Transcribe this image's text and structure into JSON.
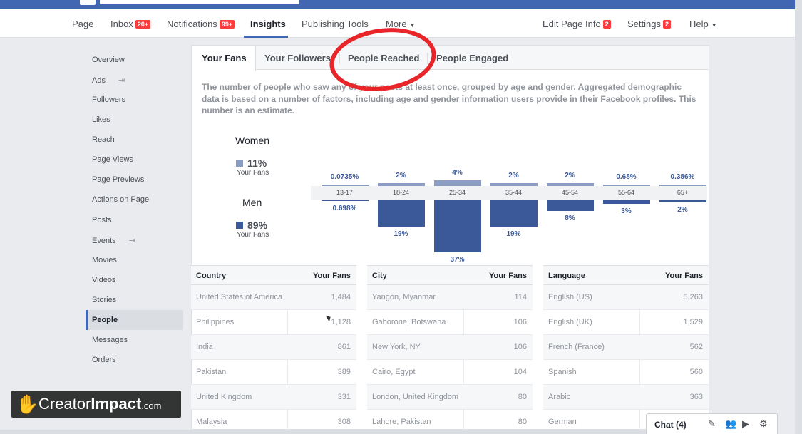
{
  "nav": {
    "page": "Page",
    "inbox": "Inbox",
    "inbox_badge": "20+",
    "notifications": "Notifications",
    "notifications_badge": "99+",
    "insights": "Insights",
    "publishing_tools": "Publishing Tools",
    "more": "More",
    "edit_page_info": "Edit Page Info",
    "edit_badge": "2",
    "settings": "Settings",
    "settings_badge": "2",
    "help": "Help"
  },
  "sidebar": {
    "items": [
      {
        "label": "Overview"
      },
      {
        "label": "Ads"
      },
      {
        "label": "Followers"
      },
      {
        "label": "Likes"
      },
      {
        "label": "Reach"
      },
      {
        "label": "Page Views"
      },
      {
        "label": "Page Previews"
      },
      {
        "label": "Actions on Page"
      },
      {
        "label": "Posts"
      },
      {
        "label": "Events"
      },
      {
        "label": "Movies"
      },
      {
        "label": "Videos"
      },
      {
        "label": "Stories"
      },
      {
        "label": "People"
      },
      {
        "label": "Messages"
      },
      {
        "label": "Orders"
      }
    ],
    "active": "People"
  },
  "tabs": [
    "Your Fans",
    "Your Followers",
    "People Reached",
    "People Engaged"
  ],
  "description": "The number of people who saw any of your posts at least once, grouped by age and gender. Aggregated demographic data is based on a number of factors, including age and gender information users provide in their Facebook profiles. This number is an estimate.",
  "demographics": {
    "women_label": "Women",
    "women_pct": "11%",
    "women_sub": "Your Fans",
    "men_label": "Men",
    "men_pct": "89%",
    "men_sub": "Your Fans",
    "colors": {
      "women": "#8b9dc3",
      "men": "#3b5998"
    }
  },
  "chart_data": {
    "type": "bar",
    "categories": [
      "13-17",
      "18-24",
      "25-34",
      "35-44",
      "45-54",
      "55-64",
      "65+"
    ],
    "series": [
      {
        "name": "Women",
        "values": [
          0.0735,
          2,
          4,
          2,
          2,
          0.68,
          0.386
        ],
        "labels": [
          "0.0735%",
          "2%",
          "4%",
          "2%",
          "2%",
          "0.68%",
          "0.386%"
        ]
      },
      {
        "name": "Men",
        "values": [
          0.698,
          19,
          37,
          19,
          8,
          3,
          2
        ],
        "labels": [
          "0.698%",
          "19%",
          "37%",
          "19%",
          "8%",
          "3%",
          "2%"
        ]
      }
    ]
  },
  "tables": {
    "country": {
      "headers": [
        "Country",
        "Your Fans"
      ],
      "rows": [
        [
          "United States of America",
          "1,484"
        ],
        [
          "Philippines",
          "1,128"
        ],
        [
          "India",
          "861"
        ],
        [
          "Pakistan",
          "389"
        ],
        [
          "United Kingdom",
          "331"
        ],
        [
          "Malaysia",
          "308"
        ]
      ]
    },
    "city": {
      "headers": [
        "City",
        "Your Fans"
      ],
      "rows": [
        [
          "Yangon, Myanmar",
          "114"
        ],
        [
          "Gaborone, Botswana",
          "106"
        ],
        [
          "New York, NY",
          "106"
        ],
        [
          "Cairo, Egypt",
          "104"
        ],
        [
          "London, United Kingdom",
          "80"
        ],
        [
          "Lahore, Pakistan",
          "80"
        ]
      ]
    },
    "language": {
      "headers": [
        "Language",
        "Your Fans"
      ],
      "rows": [
        [
          "English (US)",
          "5,263"
        ],
        [
          "English (UK)",
          "1,529"
        ],
        [
          "French (France)",
          "562"
        ],
        [
          "Spanish",
          "560"
        ],
        [
          "Arabic",
          "363"
        ],
        [
          "German",
          ""
        ]
      ]
    }
  },
  "watermark": {
    "brand_a": "Creator",
    "brand_b": "Impact",
    "brand_c": ".com"
  },
  "chat": {
    "label": "Chat (4)"
  }
}
